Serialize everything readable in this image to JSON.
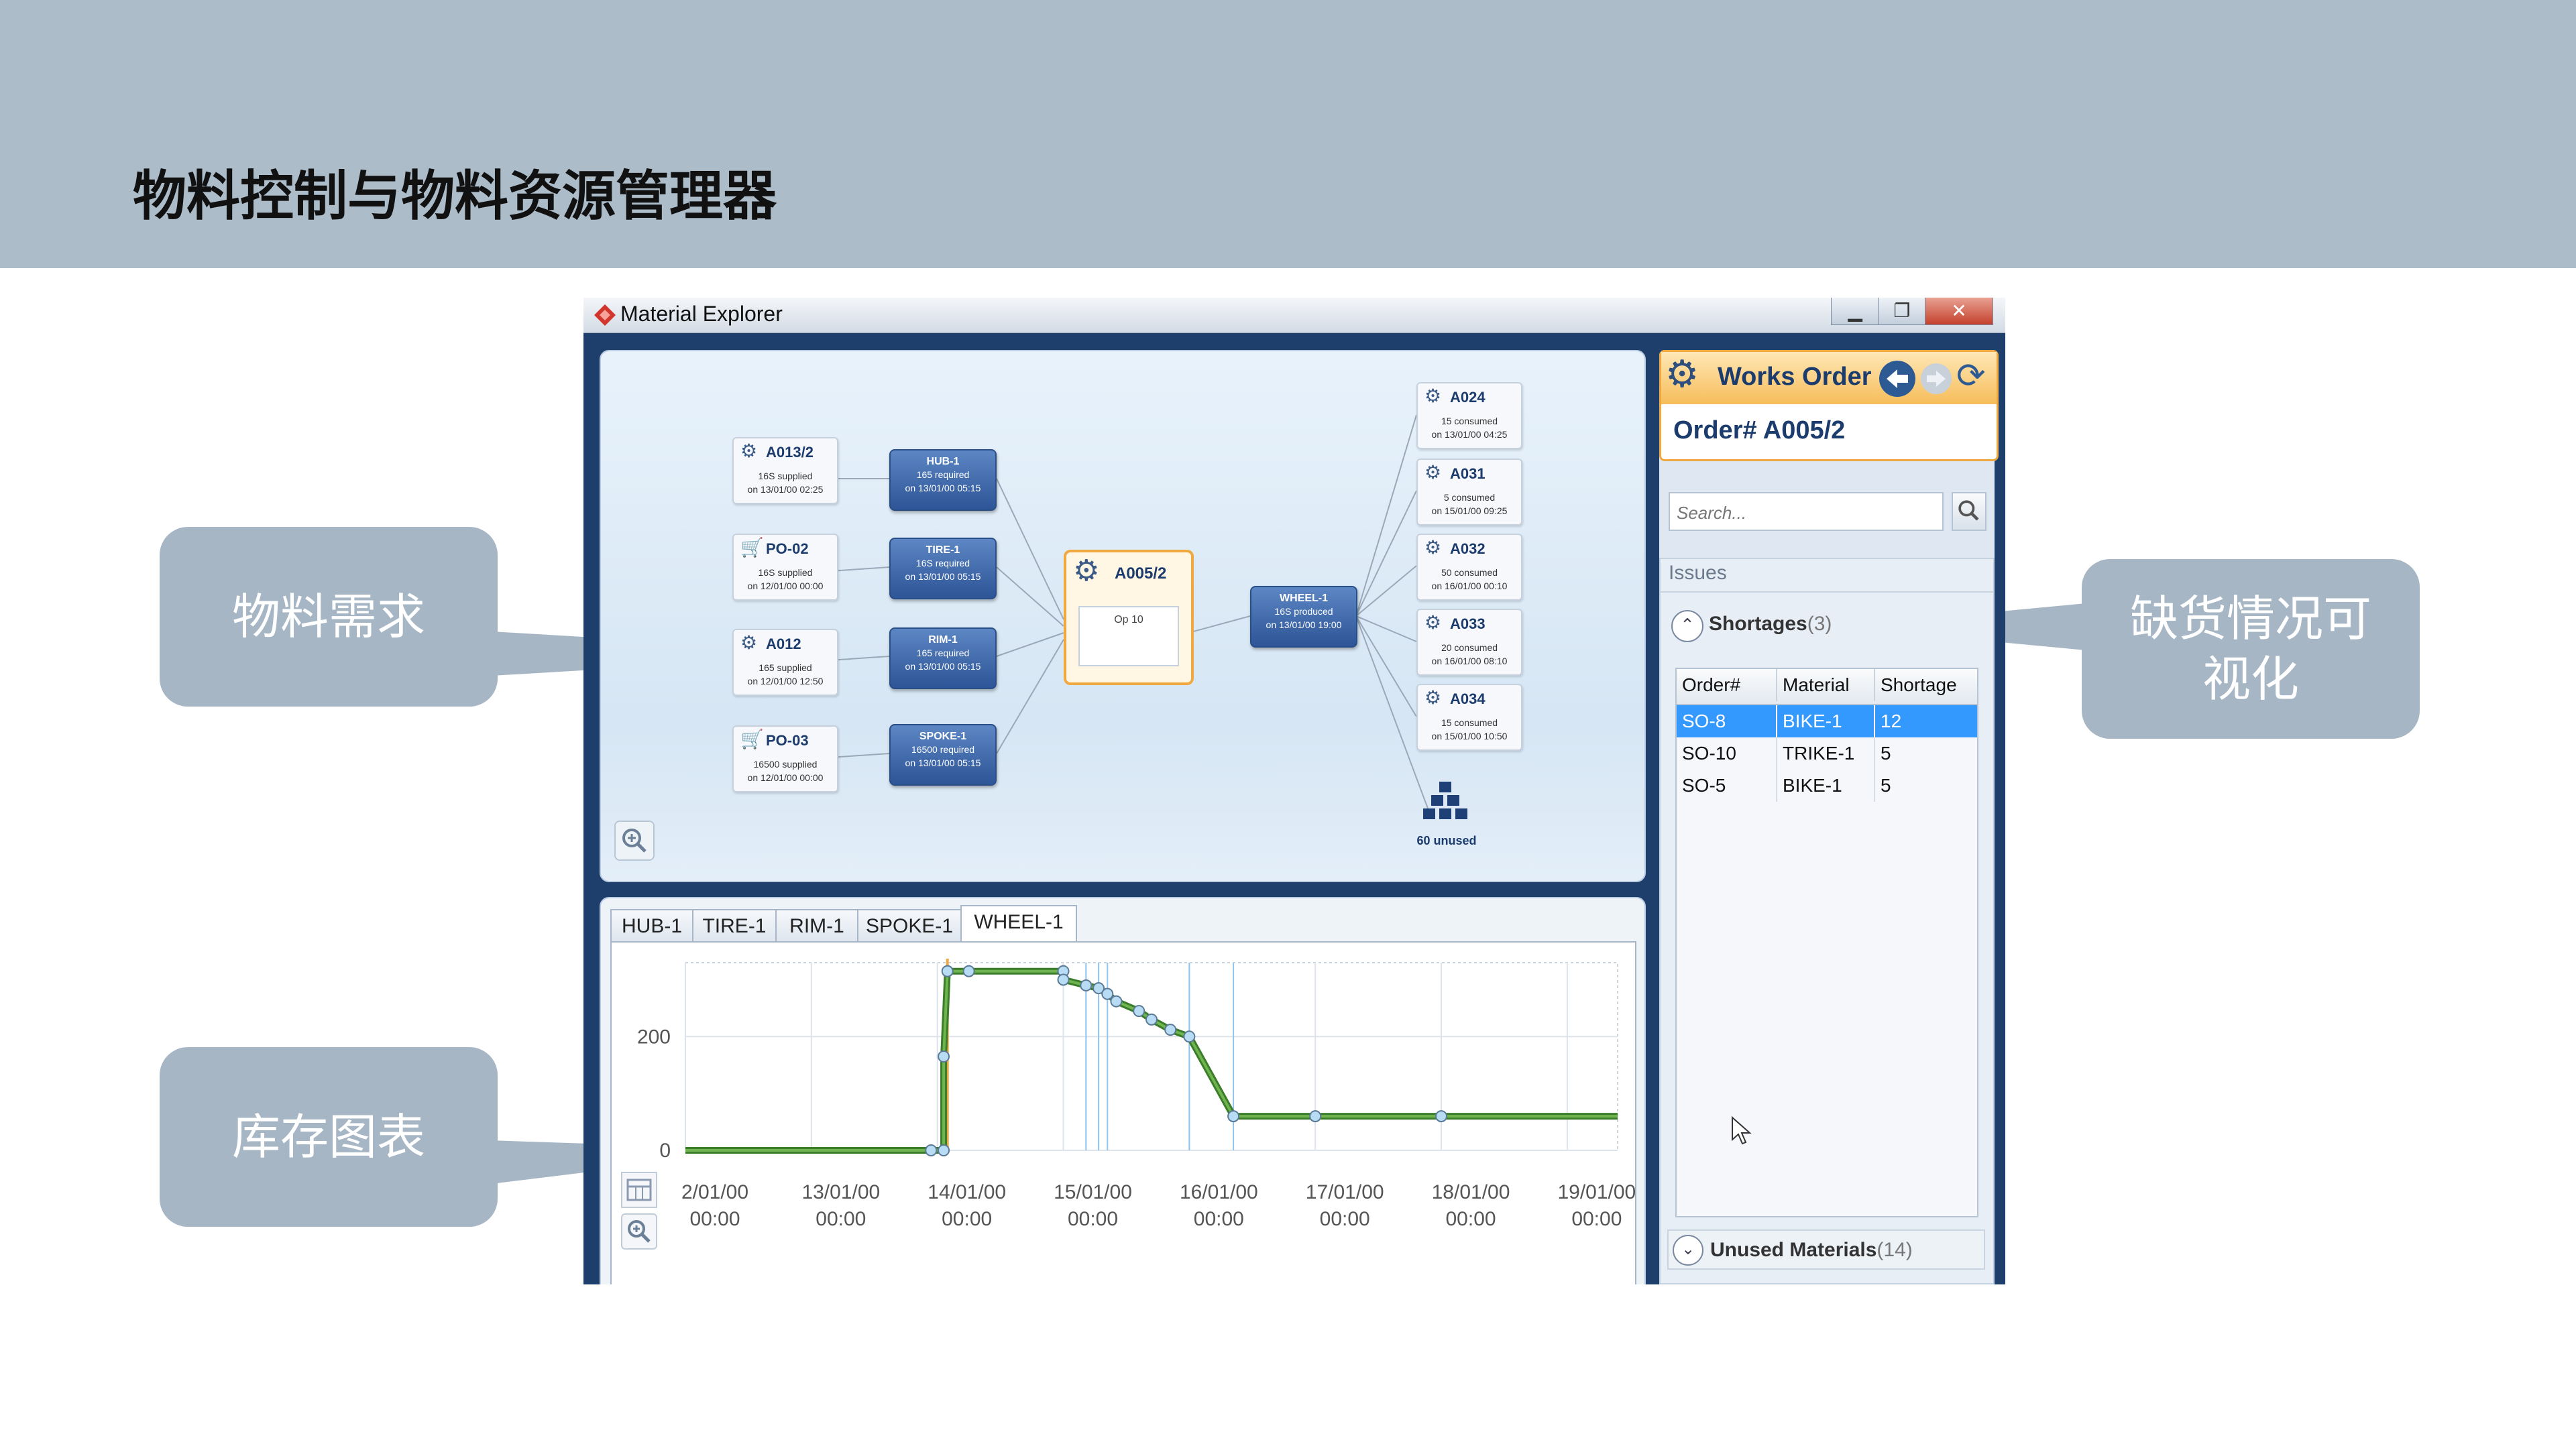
{
  "slide": {
    "title": "物料控制与物料资源管理器",
    "callouts": {
      "material_demand": "物料需求",
      "inventory_chart": "库存图表",
      "shortage_visual": "缺货情况可\n视化"
    }
  },
  "window": {
    "title": "Material Explorer",
    "controls": {
      "minimize": "▁",
      "maximize": "❐",
      "close": "✕"
    }
  },
  "graph": {
    "sources": [
      {
        "title": "A013/2",
        "icon": "gear-icon",
        "line1": "16S supplied",
        "line2": "on 13/01/00 02:25"
      },
      {
        "title": "PO-02",
        "icon": "cart-icon",
        "line1": "16S supplied",
        "line2": "on 12/01/00 00:00"
      },
      {
        "title": "A012",
        "icon": "gear-icon",
        "line1": "165 supplied",
        "line2": "on 12/01/00 12:50"
      },
      {
        "title": "PO-03",
        "icon": "cart-icon",
        "line1": "16500 supplied",
        "line2": "on 12/01/00 00:00"
      }
    ],
    "components": [
      {
        "title": "HUB-1",
        "line1": "165 required",
        "line2": "on 13/01/00 05:15"
      },
      {
        "title": "TIRE-1",
        "line1": "16S required",
        "line2": "on 13/01/00 05:15"
      },
      {
        "title": "RIM-1",
        "line1": "165 required",
        "line2": "on 13/01/00 05:15"
      },
      {
        "title": "SPOKE-1",
        "line1": "16500 required",
        "line2": "on 13/01/00 05:15"
      }
    ],
    "center": {
      "title": "A005/2",
      "op": "Op 10"
    },
    "product": {
      "title": "WHEEL-1",
      "line1": "16S produced",
      "line2": "on 13/01/00 19:00"
    },
    "consumers": [
      {
        "title": "A024",
        "line1": "15 consumed",
        "line2": "on 13/01/00 04:25"
      },
      {
        "title": "A031",
        "line1": "5 consumed",
        "line2": "on 15/01/00 09:25"
      },
      {
        "title": "A032",
        "line1": "50 consumed",
        "line2": "on 16/01/00 00:10"
      },
      {
        "title": "A033",
        "line1": "20 consumed",
        "line2": "on 16/01/00 08:10"
      },
      {
        "title": "A034",
        "line1": "15 consumed",
        "line2": "on 15/01/00 10:50"
      }
    ],
    "unused_label": "60 unused"
  },
  "chart": {
    "tabs": [
      "HUB-1",
      "TIRE-1",
      "RIM-1",
      "SPOKE-1",
      "WHEEL-1"
    ],
    "active_tab": "WHEEL-1"
  },
  "chart_data": {
    "type": "line",
    "title": "",
    "xlabel": "",
    "ylabel": "",
    "x_ticks": [
      "2/01/00\n00:00",
      "13/01/00\n00:00",
      "14/01/00\n00:00",
      "15/01/00\n00:00",
      "16/01/00\n00:00",
      "17/01/00\n00:00",
      "18/01/00\n00:00",
      "19/01/00\n00:00"
    ],
    "y_ticks": [
      0,
      200
    ],
    "ylim": [
      0,
      330
    ],
    "grid": true,
    "series": [
      {
        "x": [
          12.0,
          13.95,
          14.05,
          14.05,
          14.08,
          14.25,
          15.0,
          15.0,
          15.18,
          15.28,
          15.35,
          15.42,
          15.6,
          15.7,
          15.85,
          16.0,
          16.35,
          17.0,
          18.0,
          19.4
        ],
        "y": [
          0,
          0,
          0,
          165,
          315,
          315,
          315,
          300,
          290,
          285,
          275,
          262,
          245,
          230,
          212,
          200,
          60,
          60,
          60,
          60
        ]
      }
    ]
  },
  "right": {
    "works_order_title": "Works Order",
    "order_label": "Order# A005/2",
    "search_placeholder": "Search...",
    "issues_label": "Issues",
    "shortages_label": "Shortages",
    "shortages_count": "(3)",
    "table": {
      "headers": [
        "Order#",
        "Material",
        "Shortage"
      ],
      "rows": [
        [
          "SO-8",
          "BIKE-1",
          "12"
        ],
        [
          "SO-10",
          "TRIKE-1",
          "5"
        ],
        [
          "SO-5",
          "BIKE-1",
          "5"
        ]
      ]
    },
    "unused_materials_label": "Unused Materials",
    "unused_materials_count": "(14)"
  },
  "colors": {
    "banner": "#adbcc9",
    "callout": "#a6b6c4",
    "window_frame": "#1e3f6c",
    "accent_orange": "#f0a941",
    "selected_row": "#3399ff",
    "stock_line": "#3a7d2a",
    "demand_line": "#f0a941"
  }
}
